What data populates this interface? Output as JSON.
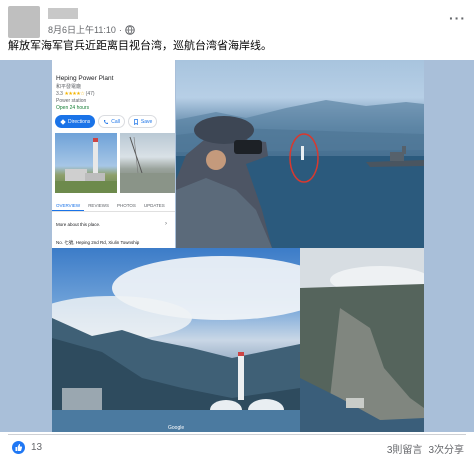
{
  "post": {
    "timestamp": "8月6日上午11:10",
    "privacy_sep": "·",
    "more_label": "···",
    "caption": "解放军海军官兵近距离目视台湾，巡航台湾省海岸线。"
  },
  "maps_card": {
    "place_name": "Heping Power Plant",
    "place_name_local": "和平發電廠",
    "rating": "3.3",
    "stars": "★★★★☆",
    "review_count": "(47)",
    "category": "Power station",
    "hours": "Open 24 hours",
    "buttons": [
      {
        "label": "Directions"
      },
      {
        "label": "Call"
      },
      {
        "label": "Save"
      }
    ],
    "tabs": [
      {
        "label": "OVERVIEW"
      },
      {
        "label": "REVIEWS"
      },
      {
        "label": "PHOTOS"
      },
      {
        "label": "UPDATES"
      }
    ],
    "more_about": "More about this place.",
    "address": "No. 七號, Heping 2nd Rd, Xiulin Township"
  },
  "map_watermark": "Google",
  "footer": {
    "reaction_count": "13",
    "comments": "3則留言",
    "shares": "3次分享"
  },
  "colors": {
    "accent": "#1a73e8",
    "like": "#2078f4",
    "muted_text": "#65676b"
  }
}
